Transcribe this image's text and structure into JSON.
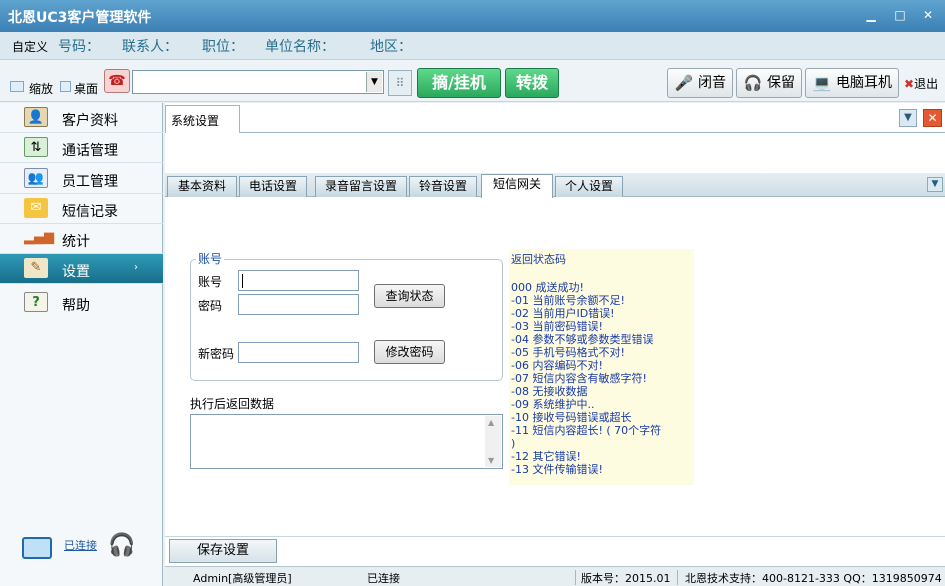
{
  "window": {
    "title": "北恩UC3客户管理软件",
    "min": "▁",
    "max": "□",
    "close": "✕"
  },
  "infobar": {
    "custom": "自定义",
    "fields": [
      "号码：",
      "联系人：",
      "职位：",
      "单位名称：",
      "地区："
    ]
  },
  "toolbar": {
    "shrink": "缩放",
    "desktop": "桌面",
    "dial_value": "",
    "hook_button": "摘/挂机",
    "transfer_button": "转拨",
    "mute_button": "闭音",
    "hold_button": "保留",
    "pc_headset_button": "电脑耳机",
    "exit": "退出"
  },
  "sidebar": {
    "items": [
      {
        "label": "客户资料",
        "icon": "customer-icon"
      },
      {
        "label": "通话管理",
        "icon": "call-icon"
      },
      {
        "label": "员工管理",
        "icon": "staff-icon"
      },
      {
        "label": "短信记录",
        "icon": "envelope-icon"
      },
      {
        "label": "统计",
        "icon": "bar-chart-icon"
      },
      {
        "label": "设置",
        "icon": "settings-icon",
        "active": true
      },
      {
        "label": "帮助",
        "icon": "help-icon"
      }
    ],
    "connection": "已连接"
  },
  "main": {
    "doc_tab": "系统设置",
    "tabs": [
      "基本资料",
      "电话设置",
      "录音留言设置",
      "铃音设置",
      "短信网关",
      "个人设置"
    ],
    "active_tab": "短信网关",
    "account_group": "账号",
    "account_label": "账号",
    "password_label": "密码",
    "new_password_label": "新密码",
    "account_value": "",
    "password_value": "",
    "new_password_value": "",
    "query_button": "查询状态",
    "change_password_button": "修改密码",
    "result_label": "执行后返回数据",
    "result_value": "",
    "codes_title": "返回状态码",
    "codes": [
      "000 成送成功!",
      "-01 当前账号余额不足!",
      "-02 当前用户ID错误!",
      "-03 当前密码错误!",
      "-04 参数不够或参数类型错误",
      "-05 手机号码格式不对!",
      "-06 内容编码不对!",
      "-07 短信内容含有敏感字符!",
      "-08 无接收数据",
      "-09 系统维护中..",
      "-10 接收号码错误或超长",
      "-11 短信内容超长! ( 70个字符",
      ")",
      "-12 其它错误!",
      "-13 文件传输错误!"
    ],
    "save_button": "保存设置"
  },
  "statusbar": {
    "user": "Admin[高级管理员]",
    "connection": "已连接",
    "version": "版本号：2015.01",
    "support": "北恩技术支持：400-8121-333 QQ：1319850974"
  },
  "colors": {
    "active_nav": "#1f86a3",
    "green_button": "#2aa85c",
    "title_bar": "#4a8fc2",
    "codes_bg": "#fdfbe0"
  }
}
